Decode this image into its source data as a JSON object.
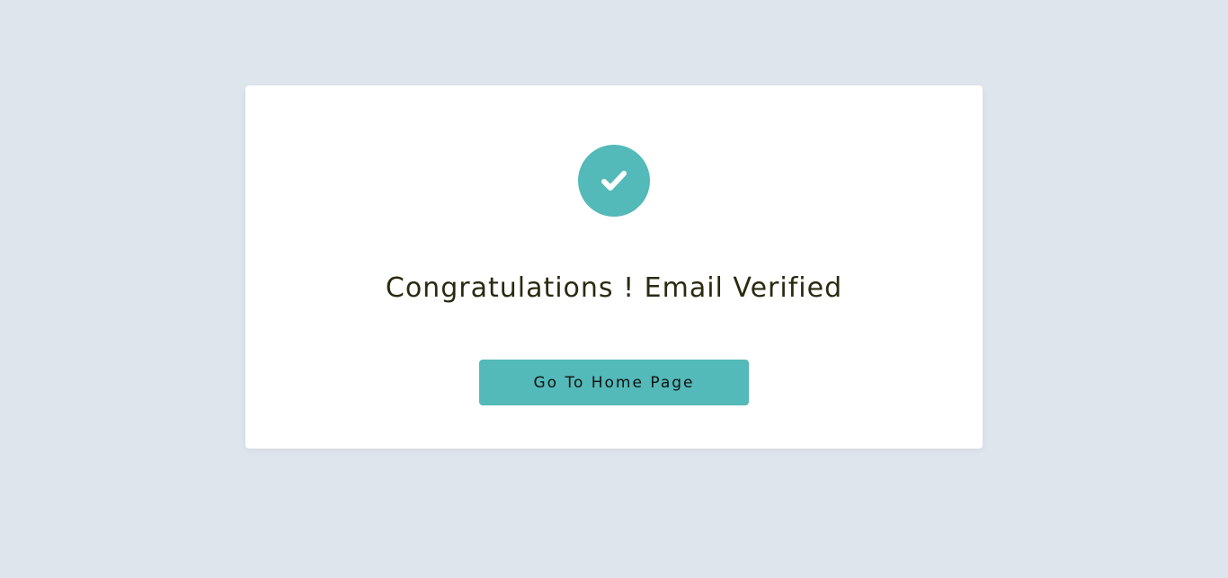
{
  "verification": {
    "title": "Congratulations ! Email Verified",
    "button_label": "Go To Home Page",
    "status_icon": "check-circle-icon"
  },
  "colors": {
    "background": "#dfe5ed",
    "card": "#ffffff",
    "accent": "#53b9b9",
    "title_text": "#2b2a10",
    "button_text": "#111111"
  }
}
